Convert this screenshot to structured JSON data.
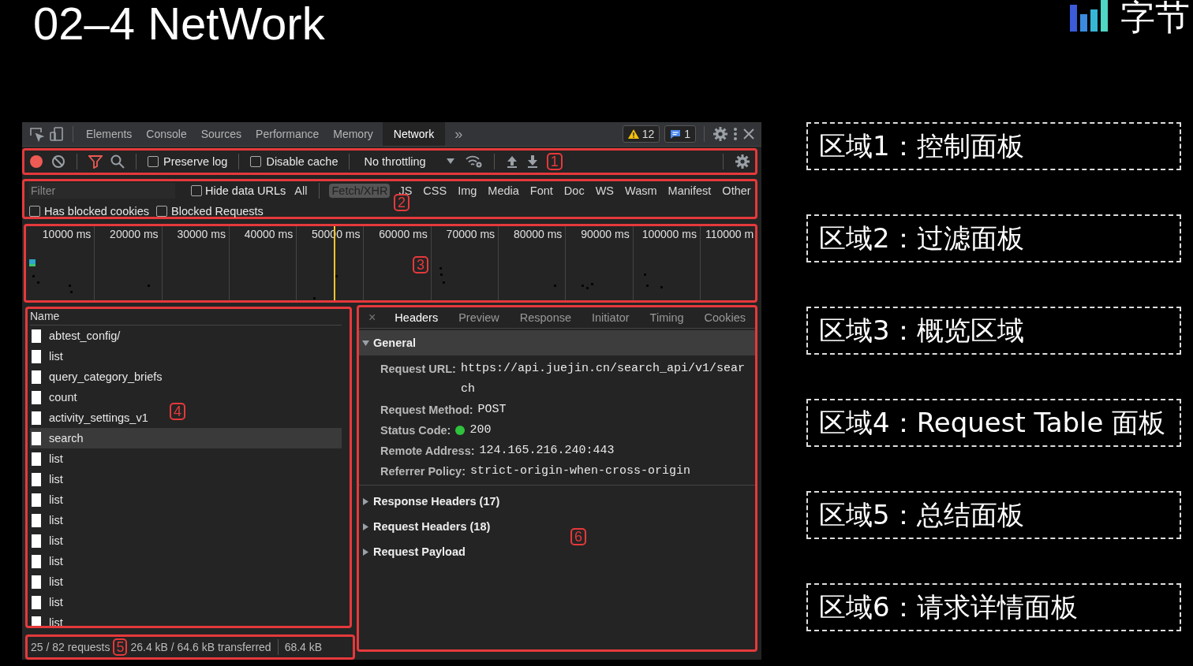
{
  "slide": {
    "title": "02–4 NetWork",
    "logo_text": "字节"
  },
  "devtools": {
    "tabs": [
      {
        "label": "Elements",
        "selected": false
      },
      {
        "label": "Console",
        "selected": false
      },
      {
        "label": "Sources",
        "selected": false
      },
      {
        "label": "Performance",
        "selected": false
      },
      {
        "label": "Memory",
        "selected": false
      },
      {
        "label": "Network",
        "selected": true
      }
    ],
    "more_tabs": "»",
    "warnings": "12",
    "messages": "1",
    "toolbar": {
      "recording": true,
      "filter_active": true,
      "options": [
        {
          "label": "Preserve log",
          "checked": false
        },
        {
          "label": "Disable cache",
          "checked": false
        }
      ],
      "throttling": "No throttling",
      "annotation": "1"
    },
    "filter": {
      "placeholder": "Filter",
      "hide_data_urls": {
        "label": "Hide data URLs",
        "checked": false
      },
      "types": [
        {
          "label": "All",
          "selected": false
        },
        {
          "label": "Fetch/XHR",
          "selected": true
        },
        {
          "label": "JS",
          "selected": false
        },
        {
          "label": "CSS",
          "selected": false
        },
        {
          "label": "Img",
          "selected": false
        },
        {
          "label": "Media",
          "selected": false
        },
        {
          "label": "Font",
          "selected": false
        },
        {
          "label": "Doc",
          "selected": false
        },
        {
          "label": "WS",
          "selected": false
        },
        {
          "label": "Wasm",
          "selected": false
        },
        {
          "label": "Manifest",
          "selected": false
        },
        {
          "label": "Other",
          "selected": false
        }
      ],
      "options": [
        {
          "label": "Has blocked cookies",
          "checked": false
        },
        {
          "label": "Blocked Requests",
          "checked": false
        }
      ],
      "annotation": "2"
    },
    "overview": {
      "ticks": [
        "10000 ms",
        "20000 ms",
        "30000 ms",
        "40000 ms",
        "50000 ms",
        "60000 ms",
        "70000 ms",
        "80000 ms",
        "90000 ms",
        "100000 ms",
        "110000 m"
      ],
      "annotation": "3"
    },
    "requests": {
      "column": "Name",
      "annotation": "4",
      "rows": [
        {
          "name": "abtest_config/",
          "selected": false
        },
        {
          "name": "list",
          "selected": false
        },
        {
          "name": "query_category_briefs",
          "selected": false
        },
        {
          "name": "count",
          "selected": false
        },
        {
          "name": "activity_settings_v1",
          "selected": false
        },
        {
          "name": "search",
          "selected": true
        },
        {
          "name": "list",
          "selected": false
        },
        {
          "name": "list",
          "selected": false
        },
        {
          "name": "list",
          "selected": false
        },
        {
          "name": "list",
          "selected": false
        },
        {
          "name": "list",
          "selected": false
        },
        {
          "name": "list",
          "selected": false
        },
        {
          "name": "list",
          "selected": false
        },
        {
          "name": "list",
          "selected": false
        },
        {
          "name": "list",
          "selected": false
        }
      ]
    },
    "summary": {
      "requests": "25 / 82 requests",
      "annotation": "5",
      "transferred": "26.4 kB / 64.6 kB transferred",
      "resources": "68.4 kB"
    },
    "details": {
      "close": "×",
      "annotation": "6",
      "tabs": [
        {
          "label": "Headers",
          "selected": true
        },
        {
          "label": "Preview",
          "selected": false
        },
        {
          "label": "Response",
          "selected": false
        },
        {
          "label": "Initiator",
          "selected": false
        },
        {
          "label": "Timing",
          "selected": false
        },
        {
          "label": "Cookies",
          "selected": false
        }
      ],
      "sections": [
        {
          "title": "General",
          "expanded": true,
          "fields": [
            {
              "kind": "text",
              "label": "Request URL:",
              "value": "https://api.juejin.cn/search_api/v1/search"
            },
            {
              "kind": "text",
              "label": "Request Method:",
              "value": "POST"
            },
            {
              "kind": "status",
              "label": "Status Code:",
              "value": "200"
            },
            {
              "kind": "text",
              "label": "Remote Address:",
              "value": "124.165.216.240:443"
            },
            {
              "kind": "text",
              "label": "Referrer Policy:",
              "value": "strict-origin-when-cross-origin"
            }
          ]
        },
        {
          "title": "Response Headers (17)",
          "expanded": false
        },
        {
          "title": "Request Headers (18)",
          "expanded": false
        },
        {
          "title": "Request Payload",
          "expanded": false
        }
      ]
    }
  },
  "legend": [
    "区域1：控制面板",
    "区域2：过滤面板",
    "区域3：概览区域",
    "区域4：Request Table 面板",
    "区域5：总结面板",
    "区域6：请求详情面板"
  ]
}
